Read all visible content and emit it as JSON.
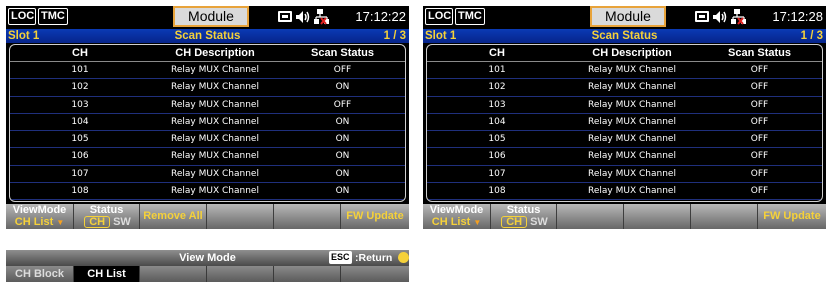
{
  "screens": [
    {
      "badges": {
        "loc": "LOC",
        "tmc": "TMC"
      },
      "title": "Module",
      "time": "17:12:22",
      "slot": "Slot 1",
      "subtitle": "Scan Status",
      "page": "1 / 3",
      "table": {
        "headers": [
          "CH",
          "CH Description",
          "Scan Status"
        ],
        "rows": [
          [
            "101",
            "Relay MUX Channel",
            "OFF"
          ],
          [
            "102",
            "Relay MUX Channel",
            "ON"
          ],
          [
            "103",
            "Relay MUX Channel",
            "OFF"
          ],
          [
            "104",
            "Relay MUX Channel",
            "ON"
          ],
          [
            "105",
            "Relay MUX Channel",
            "ON"
          ],
          [
            "106",
            "Relay MUX Channel",
            "ON"
          ],
          [
            "107",
            "Relay MUX Channel",
            "ON"
          ],
          [
            "108",
            "Relay MUX Channel",
            "ON"
          ]
        ]
      },
      "softkeys": {
        "viewmode": "ViewMode",
        "viewmode_value": "CH List",
        "status": "Status",
        "status_ch": "CH",
        "status_sw": "SW",
        "remove_all": "Remove All",
        "fw_update": "FW Update"
      }
    },
    {
      "badges": {
        "loc": "LOC",
        "tmc": "TMC"
      },
      "title": "Module",
      "time": "17:12:28",
      "slot": "Slot 1",
      "subtitle": "Scan Status",
      "page": "1 / 3",
      "table": {
        "headers": [
          "CH",
          "CH Description",
          "Scan Status"
        ],
        "rows": [
          [
            "101",
            "Relay MUX Channel",
            "OFF"
          ],
          [
            "102",
            "Relay MUX Channel",
            "OFF"
          ],
          [
            "103",
            "Relay MUX Channel",
            "OFF"
          ],
          [
            "104",
            "Relay MUX Channel",
            "OFF"
          ],
          [
            "105",
            "Relay MUX Channel",
            "OFF"
          ],
          [
            "106",
            "Relay MUX Channel",
            "OFF"
          ],
          [
            "107",
            "Relay MUX Channel",
            "OFF"
          ],
          [
            "108",
            "Relay MUX Channel",
            "OFF"
          ]
        ]
      },
      "softkeys": {
        "viewmode": "ViewMode",
        "viewmode_value": "CH List",
        "status": "Status",
        "status_ch": "CH",
        "status_sw": "SW",
        "fw_update": "FW Update"
      }
    }
  ],
  "view_mode_menu": {
    "title": "View Mode",
    "esc_label": "ESC",
    "return_label": ":Return",
    "options": [
      "CH Block",
      "CH List"
    ],
    "selected": "CH List"
  },
  "icons": [
    "keyboard-icon",
    "speaker-icon",
    "network-icon",
    "return-icon",
    "dropdown-arrow-icon"
  ],
  "colors": {
    "screen_bg": "#000000",
    "slot_bar": "#0a3ab4",
    "highlight": "#f5d13a",
    "title_border": "#e8a33a",
    "row_divider": "#1f2f7c"
  }
}
